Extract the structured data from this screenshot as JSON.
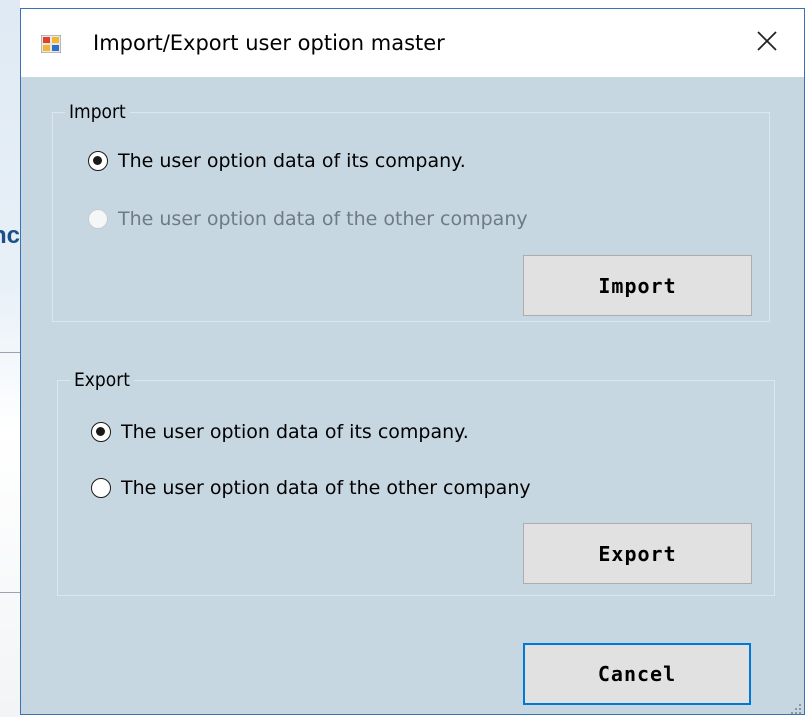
{
  "window": {
    "title": "Import/Export user option master",
    "close_icon": "close-icon"
  },
  "import_group": {
    "legend": "Import",
    "options": [
      {
        "label": "The user option data of its company.",
        "checked": true,
        "enabled": true
      },
      {
        "label": "The user option data of the other company",
        "checked": false,
        "enabled": false
      }
    ],
    "button_label": "Import"
  },
  "export_group": {
    "legend": "Export",
    "options": [
      {
        "label": "The user option data of its company.",
        "checked": true,
        "enabled": true
      },
      {
        "label": "The user option data of the other company",
        "checked": false,
        "enabled": true
      }
    ],
    "button_label": "Export"
  },
  "footer": {
    "cancel_label": "Cancel"
  },
  "background_fragment": {
    "text": "nc"
  },
  "colors": {
    "dialog_bg": "#c7d7e2",
    "window_border": "#3a72b8",
    "default_button_border": "#0078d7"
  }
}
